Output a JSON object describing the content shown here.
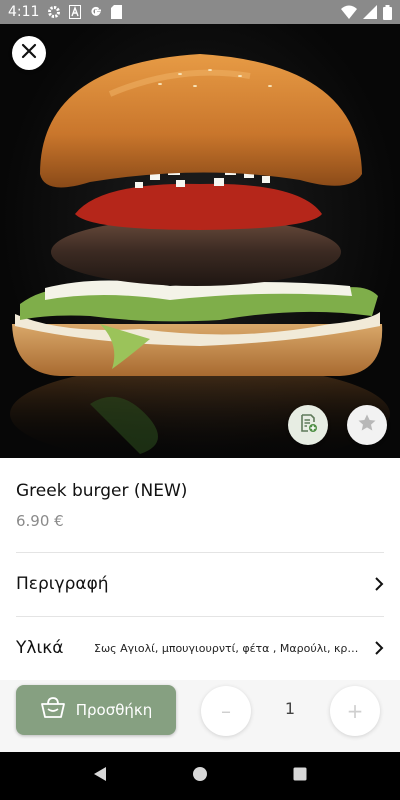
{
  "status_bar": {
    "time": "4:11",
    "icons_left": [
      "gear-icon",
      "a-icon",
      "google-icon",
      "sd-card-icon"
    ],
    "icons_right": [
      "wifi-icon",
      "signal-icon",
      "battery-icon"
    ]
  },
  "hero": {
    "image": "burger-photo",
    "buttons": [
      "close-icon",
      "note-add-icon",
      "star-icon"
    ]
  },
  "product": {
    "name": "Greek burger (NEW)",
    "price": "6.90 €"
  },
  "rows": {
    "description_label": "Περιγραφή",
    "ingredients_label": "Υλικά",
    "ingredients_text": "Σως Αγιολί, μπουγιουρντί, φέτα , Μαρούλι, κρεμμύδι..."
  },
  "cart": {
    "add_label": "Προσθήκη",
    "quantity": "1",
    "minus": "–",
    "plus": "+"
  },
  "nav": [
    "back-icon",
    "home-icon",
    "recents-icon"
  ],
  "colors": {
    "status_bar": "#8a8a8a",
    "accent": "#86a081",
    "note_button": "#e7ede3"
  }
}
